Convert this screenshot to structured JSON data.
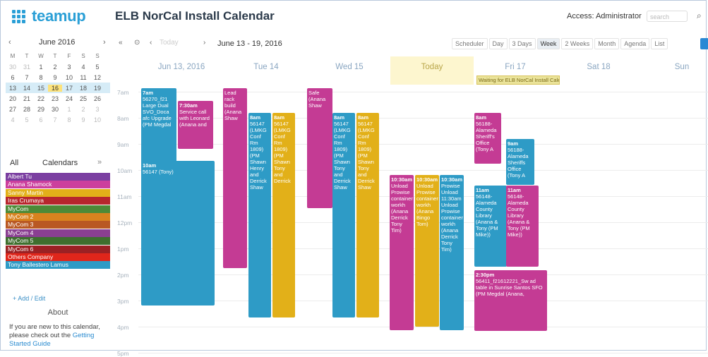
{
  "header": {
    "brand": "teamup",
    "calendar_title": "ELB NorCal Install Calendar",
    "access": "Access: Administrator",
    "search_placeholder": "search"
  },
  "mini_calendar": {
    "month_label": "June 2016",
    "prev": "‹",
    "next": "›",
    "dow": [
      "M",
      "T",
      "W",
      "T",
      "F",
      "S",
      "S"
    ],
    "weeks": [
      [
        "30",
        "31",
        "1",
        "2",
        "3",
        "4",
        "5"
      ],
      [
        "6",
        "7",
        "8",
        "9",
        "10",
        "11",
        "12"
      ],
      [
        "13",
        "14",
        "15",
        "16",
        "17",
        "18",
        "19"
      ],
      [
        "20",
        "21",
        "22",
        "23",
        "24",
        "25",
        "26"
      ],
      [
        "27",
        "28",
        "29",
        "30",
        "1",
        "2",
        "3"
      ],
      [
        "4",
        "5",
        "6",
        "7",
        "8",
        "9",
        "10"
      ]
    ]
  },
  "calendar_list": {
    "all_label": "All",
    "header": "Calendars",
    "more": "»",
    "items": [
      {
        "name": "Albert Tu",
        "color": "#7b3fa1"
      },
      {
        "name": "Anana Shamock",
        "color": "#cc3f9d"
      },
      {
        "name": "Sanny Martin",
        "color": "#e2b019"
      },
      {
        "name": "Iras Crumaya",
        "color": "#b7262d"
      },
      {
        "name": "MyCom",
        "color": "#4d8a37"
      },
      {
        "name": "MyCom 2",
        "color": "#d8831f"
      },
      {
        "name": "MyCom 3",
        "color": "#b95823"
      },
      {
        "name": "MyCom 4",
        "color": "#8a3f91"
      },
      {
        "name": "MyCom 5",
        "color": "#3e6f2e"
      },
      {
        "name": "MyCom 6",
        "color": "#9b2124"
      },
      {
        "name": "Others Company",
        "color": "#e0261b"
      },
      {
        "name": "Tony Ballestero Lamus",
        "color": "#2e9bc6"
      }
    ],
    "add_edit": "+ Add / Edit"
  },
  "about": {
    "title": "About",
    "text": "If you are new to this calendar, please check out the",
    "link": "Getting Started Guide"
  },
  "toolbar": {
    "prev_fast": "«",
    "home": "⊙",
    "prev": "‹",
    "today": "Today",
    "next": "›",
    "range": "June 13 - 19, 2016",
    "views": [
      "Scheduler",
      "Day",
      "3 Days",
      "Week",
      "2 Weeks",
      "Month",
      "Agenda",
      "List"
    ],
    "active_view": "Week"
  },
  "days": [
    {
      "label": "Jun 13, 2016"
    },
    {
      "label": "Tue 14"
    },
    {
      "label": "Wed 15"
    },
    {
      "label": "Today"
    },
    {
      "label": "Fri 17"
    },
    {
      "label": "Sat 18"
    },
    {
      "label": "Sun"
    }
  ],
  "today_banner": "Waiting for ELB NorCal Install Calendar",
  "hours": [
    "7am",
    "8am",
    "9am",
    "10am",
    "11am",
    "12pm",
    "1pm",
    "2pm",
    "3pm",
    "4pm",
    "5pm"
  ],
  "events": [
    {
      "time": "7am",
      "text": "56270_f21 Large Dual SVO_Doca afc Upgrade (PM Megdal",
      "color": "#2e9bc6"
    },
    {
      "time": "7:30am",
      "text": "Service call with Leonard (Anana and",
      "color": "#c43b94"
    },
    {
      "time": "10am",
      "text": "56147 (Tony)",
      "color": "#2e9bc6"
    },
    {
      "time": "",
      "text": "Lead rack build (Anana Shaw",
      "color": "#c43b94"
    },
    {
      "time": "8am",
      "text": "56147 (LMKG Conf Rm 1809) (PM Shawn Henry and Derrick Shaw",
      "color": "#2e9bc6"
    },
    {
      "time": "8am",
      "text": "56147 (LMKG Conf Rm 1809) (PM Shawn Tony and Derrick",
      "color": "#e2b019"
    },
    {
      "time": "",
      "text": "Safe (Anana Shaw",
      "color": "#c43b94"
    },
    {
      "time": "8am",
      "text": "56147 (LMKG Conf Rm 1809) (PM Shawn Tony and Derrick Shaw",
      "color": "#2e9bc6"
    },
    {
      "time": "8am",
      "text": "56147 (LMKG Conf Rm 1809) (PM Shawn Tony and Derrick Shaw",
      "color": "#e2b019"
    },
    {
      "time": "10:30am",
      "text": "Unload Prowise container workh (Anana Derrick Tony Tim)",
      "color": "#c43b94"
    },
    {
      "time": "10:30am",
      "text": "Unload Prowise container workh (Anana Bingo Tom)",
      "color": "#e2b019"
    },
    {
      "time": "10:30am",
      "text": "Prowise Unload 11:30am Unload Prowise container workh (Anana Derrick Tony Tim)",
      "color": "#2e9bc6"
    },
    {
      "time": "8am",
      "text": "56188- Alameda Sheriff's Office (Tony A",
      "color": "#c43b94"
    },
    {
      "time": "9am",
      "text": "56188- Alameda Sheriffs Office (Tony A",
      "color": "#2e9bc6"
    },
    {
      "time": "11am",
      "text": "56148- Alameda County Library (Anana & Tony (PM Mike))",
      "color": "#2e9bc6"
    },
    {
      "time": "11am",
      "text": "56148- Alameda County Library (Anana & Tony (PM Mike))",
      "color": "#c43b94"
    },
    {
      "time": "2:30pm",
      "text": "56411_f21612221_Sw ad table in Sunrise Santos SFO (PM Megdal (Anana,",
      "color": "#c43b94"
    }
  ]
}
